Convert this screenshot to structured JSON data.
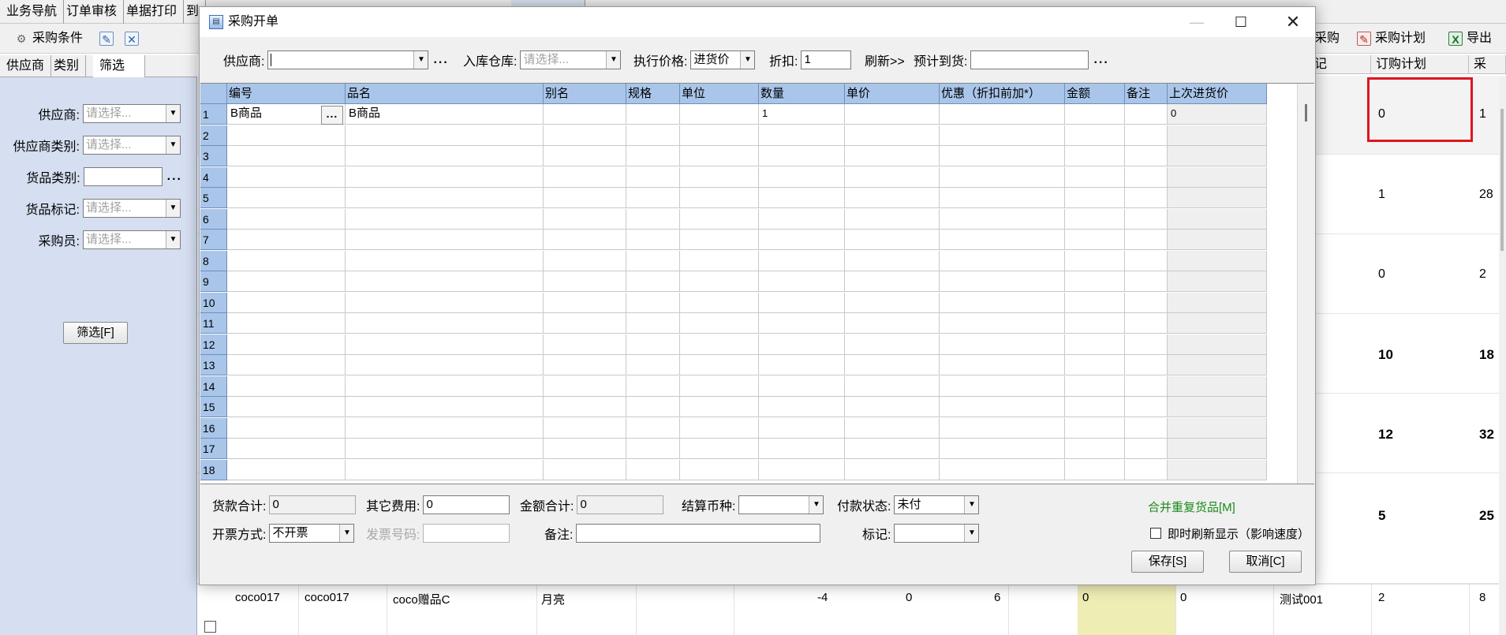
{
  "background": {
    "top_tabs": [
      "业务导航",
      "订单审核",
      "单据打印",
      "到"
    ],
    "toolbar": {
      "left": {
        "label": "采购条件"
      },
      "right": [
        {
          "label": "采购",
          "icon": "purchase-icon"
        },
        {
          "label": "采购计划",
          "icon": "purchase-plan-icon"
        },
        {
          "label": "导出",
          "icon": "excel-export-icon"
        }
      ]
    },
    "left_tabs": [
      "供应商",
      "类别",
      "筛选"
    ],
    "filters": [
      {
        "label": "供应商:",
        "placeholder": "请选择..."
      },
      {
        "label": "供应商类别:",
        "placeholder": "请选择..."
      },
      {
        "label": "货品类别:",
        "placeholder": ""
      },
      {
        "label": "货品标记:",
        "placeholder": "请选择..."
      },
      {
        "label": "采购员:",
        "placeholder": "请选择..."
      }
    ],
    "filter_button": "筛选[F]",
    "grid_headers": [
      "记",
      "订购计划",
      "采"
    ],
    "grid_rows": [
      {
        "plan": "0",
        "qty": "1",
        "bold": false
      },
      {
        "plan": "1",
        "qty": "28",
        "bold": false
      },
      {
        "plan": "0",
        "qty": "2",
        "bold": false
      },
      {
        "plan": "10",
        "qty": "18",
        "bold": true
      },
      {
        "plan": "12",
        "qty": "32",
        "bold": true
      },
      {
        "plan": "5",
        "qty": "25",
        "bold": true
      }
    ],
    "last_row": {
      "code": "coco017",
      "code2": "coco017",
      "name": "coco赠品C",
      "alias": "月亮",
      "v1": "-4",
      "v2": "0",
      "v3": "6",
      "v4": "0",
      "v5": "0",
      "user": "测试001",
      "plan": "2",
      "qty": "8"
    }
  },
  "dialog": {
    "title": "采购开单",
    "top": {
      "supplier_label": "供应商:",
      "supplier_value": "",
      "warehouse_label": "入库仓库:",
      "warehouse_placeholder": "请选择...",
      "price_label": "执行价格:",
      "price_value": "进货价",
      "discount_label": "折扣:",
      "discount_value": "1",
      "refresh_label": "刷新>>",
      "eta_label": "预计到货:",
      "eta_value": ""
    },
    "grid": {
      "headers": [
        "编号",
        "品名",
        "别名",
        "规格",
        "单位",
        "数量",
        "单价",
        "优惠（折扣前加*）",
        "金额",
        "备注",
        "上次进货价"
      ],
      "row_numbers": [
        "1",
        "2",
        "3",
        "4",
        "5",
        "6",
        "7",
        "8",
        "9",
        "10",
        "11",
        "12",
        "13",
        "14",
        "15",
        "16",
        "17",
        "18"
      ],
      "rows": [
        {
          "code": "B商品",
          "name": "B商品",
          "qty": "1",
          "last_price": "0"
        }
      ]
    },
    "footer": {
      "goods_total_label": "货款合计:",
      "goods_total_value": "0",
      "other_fee_label": "其它费用:",
      "other_fee_value": "0",
      "amount_total_label": "金额合计:",
      "amount_total_value": "0",
      "currency_label": "结算币种:",
      "currency_value": "",
      "pay_status_label": "付款状态:",
      "pay_status_value": "未付",
      "merge_link": "合并重复货品[M]",
      "invoice_method_label": "开票方式:",
      "invoice_method_value": "不开票",
      "invoice_no_label": "发票号码:",
      "invoice_no_value": "",
      "remark_label": "备注:",
      "remark_value": "",
      "mark_label": "标记:",
      "mark_value": "",
      "refresh_checkbox_label": "即时刷新显示（影响速度）",
      "save_button": "保存[S]",
      "cancel_button": "取消[C]"
    }
  },
  "colors": {
    "grid_header": "#a9c6ea",
    "filter_panel": "#d5dff1",
    "highlight": "#e0141e",
    "link_green": "#1a8a1a"
  }
}
